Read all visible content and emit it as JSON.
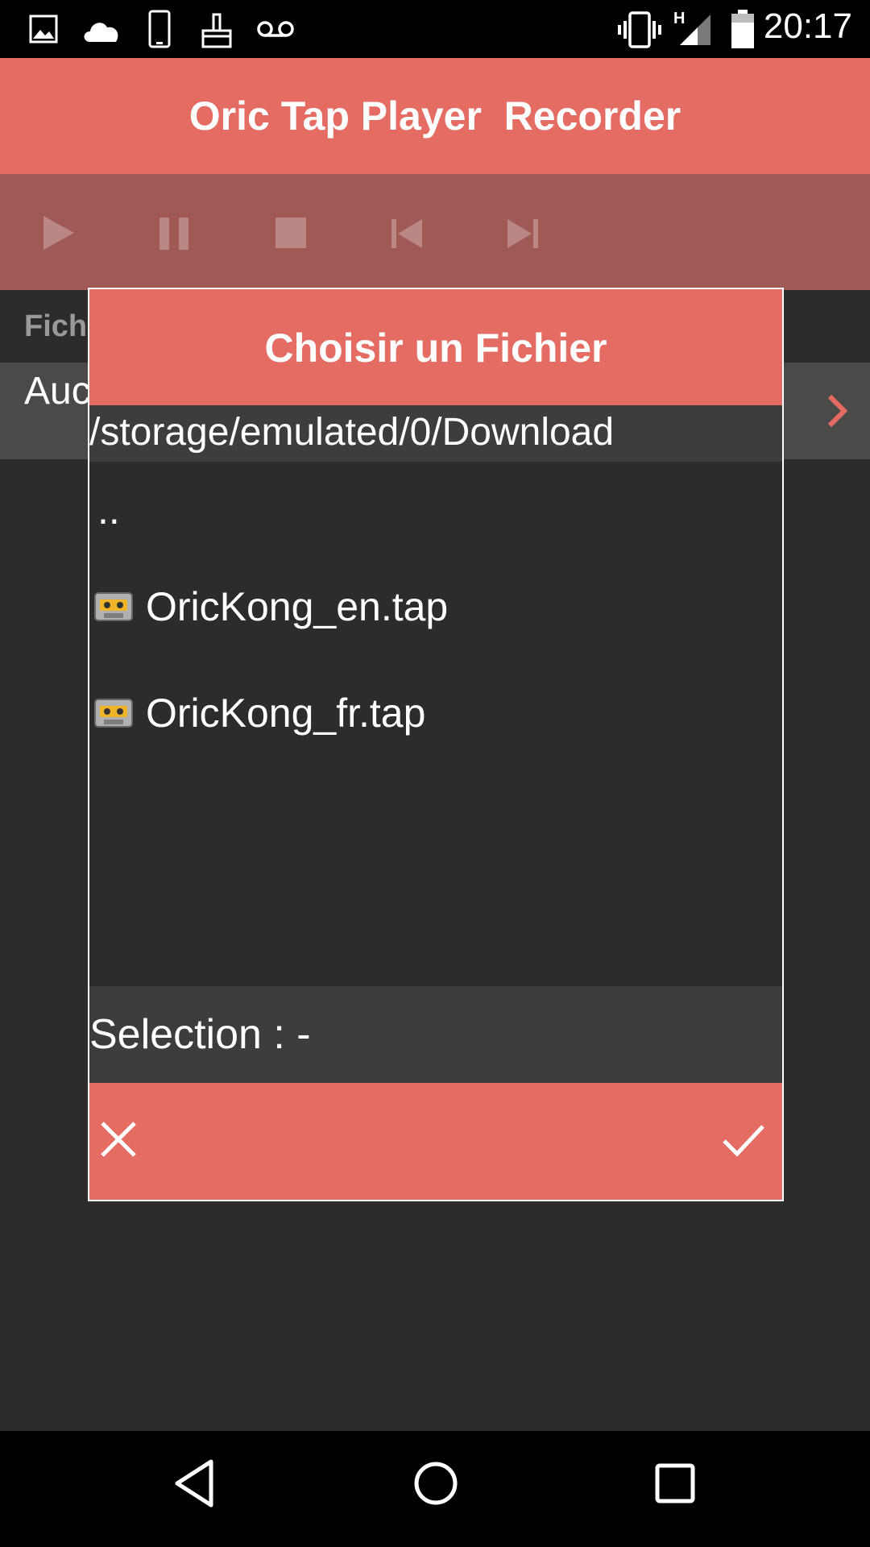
{
  "status_bar": {
    "time": "20:17",
    "network_label": "H",
    "left_icons": [
      "image-icon",
      "cloud-icon",
      "phone-icon",
      "brush-icon",
      "voicemail-icon"
    ],
    "right_icons": [
      "vibrate-icon",
      "signal-icon",
      "battery-icon"
    ]
  },
  "app": {
    "title": "Oric Tap Player  Recorder",
    "accent_color": "#e46c62",
    "transport": [
      "play-icon",
      "pause-icon",
      "stop-icon",
      "skip-previous-icon",
      "skip-next-icon"
    ]
  },
  "background": {
    "section_label": "Fich",
    "row_label": "Auc"
  },
  "dialog": {
    "title": "Choisir un Fichier",
    "path": "/storage/emulated/0/Download",
    "parent_entry": "..",
    "files": [
      {
        "name": "OricKong_en.tap",
        "icon": "cassette-icon"
      },
      {
        "name": "OricKong_fr.tap",
        "icon": "cassette-icon"
      }
    ],
    "selection": "Selection : -",
    "cancel_icon": "close-icon",
    "confirm_icon": "check-icon"
  },
  "navbar": [
    "back-icon",
    "home-icon",
    "recents-icon"
  ]
}
